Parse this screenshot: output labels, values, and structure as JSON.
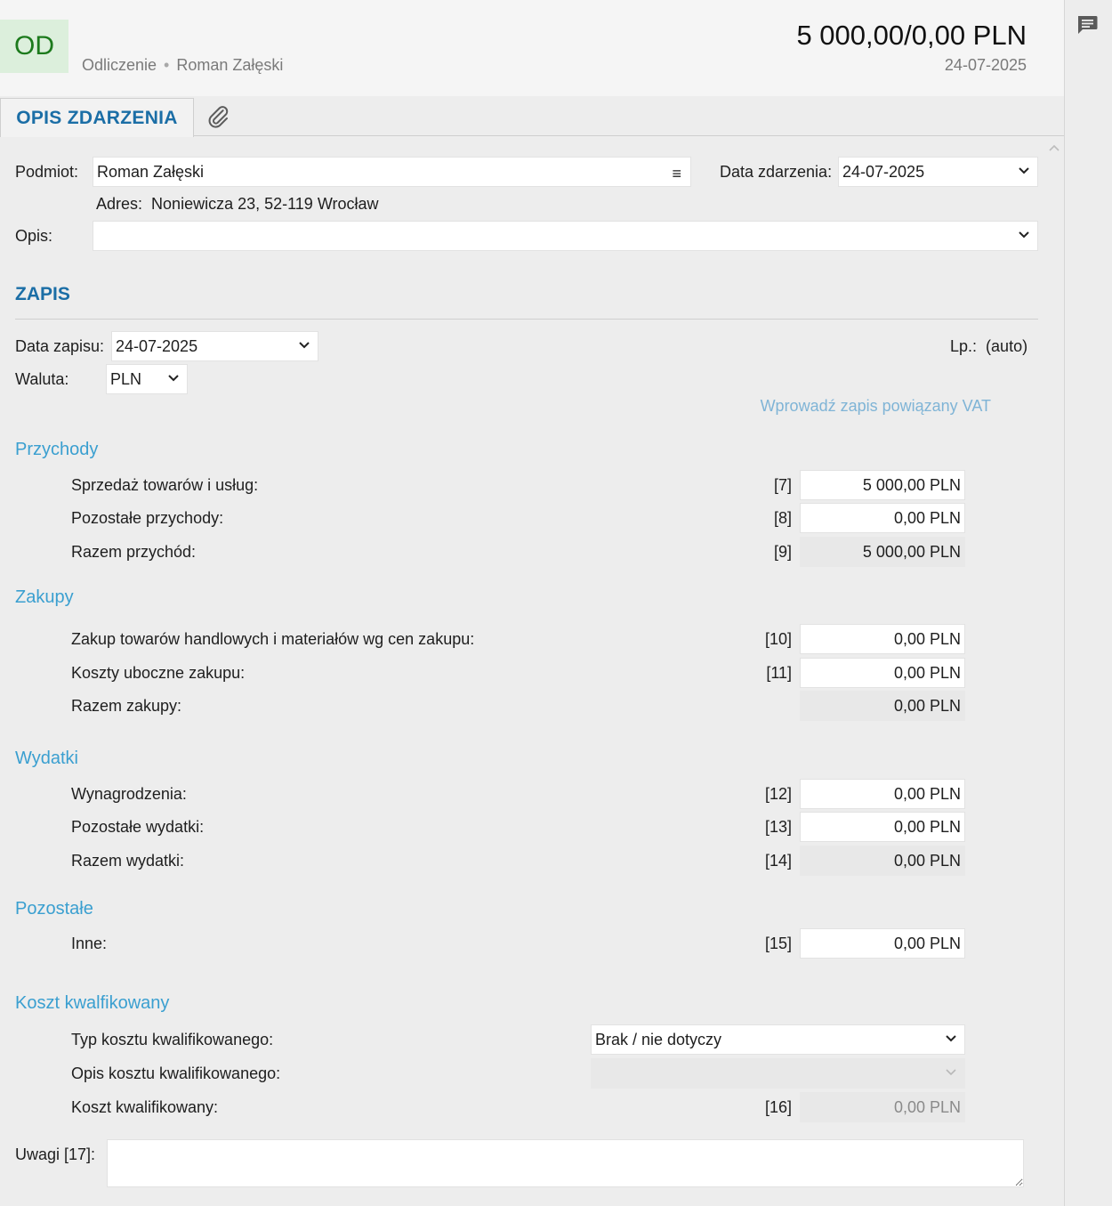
{
  "header": {
    "badge": "OD",
    "doc_type": "Odliczenie",
    "separator": "•",
    "person": "Roman Załęski",
    "amount": "5 000,00/0,00 PLN",
    "date": "24-07-2025"
  },
  "tabs": {
    "description": "OPIS ZDARZENIA"
  },
  "event": {
    "subject_label": "Podmiot:",
    "subject_value": "Roman Załęski",
    "date_label": "Data zdarzenia:",
    "date_value": "24-07-2025",
    "address_label": "Adres:",
    "address_value": "Noniewicza 23, 52-119 Wrocław",
    "desc_label": "Opis:",
    "desc_value": ""
  },
  "entry": {
    "title": "ZAPIS",
    "date_label": "Data zapisu:",
    "date_value": "24-07-2025",
    "currency_label": "Waluta:",
    "currency_value": "PLN",
    "lp_label": "Lp.:",
    "lp_value": "(auto)",
    "vat_link": "Wprowadź zapis powiązany VAT"
  },
  "income": {
    "title": "Przychody",
    "rows": [
      {
        "label": "Sprzedaż towarów i usług:",
        "code": "[7]",
        "value": "5 000,00 PLN"
      },
      {
        "label": "Pozostałe przychody:",
        "code": "[8]",
        "value": "0,00 PLN"
      },
      {
        "label": "Razem przychód:",
        "code": "[9]",
        "value": "5 000,00 PLN"
      }
    ]
  },
  "purchases": {
    "title": "Zakupy",
    "rows": [
      {
        "label": "Zakup towarów handlowych i materiałów wg cen zakupu:",
        "code": "[10]",
        "value": "0,00 PLN"
      },
      {
        "label": "Koszty uboczne zakupu:",
        "code": "[11]",
        "value": "0,00 PLN"
      },
      {
        "label": "Razem zakupy:",
        "code": "",
        "value": "0,00 PLN"
      }
    ]
  },
  "expenses": {
    "title": "Wydatki",
    "rows": [
      {
        "label": "Wynagrodzenia:",
        "code": "[12]",
        "value": "0,00 PLN"
      },
      {
        "label": "Pozostałe wydatki:",
        "code": "[13]",
        "value": "0,00 PLN"
      },
      {
        "label": "Razem wydatki:",
        "code": "[14]",
        "value": "0,00 PLN"
      }
    ]
  },
  "other": {
    "title": "Pozostałe",
    "rows": [
      {
        "label": "Inne:",
        "code": "[15]",
        "value": "0,00 PLN"
      }
    ]
  },
  "qualified": {
    "title": "Koszt kwalfikowany",
    "type_label": "Typ kosztu kwalifikowanego:",
    "type_value": "Brak / nie dotyczy",
    "desc_label": "Opis kosztu kwalifikowanego:",
    "desc_value": "",
    "amount_label": "Koszt kwalifikowany:",
    "amount_code": "[16]",
    "amount_value": "0,00 PLN"
  },
  "notes": {
    "label": "Uwagi [17]:",
    "value": ""
  }
}
